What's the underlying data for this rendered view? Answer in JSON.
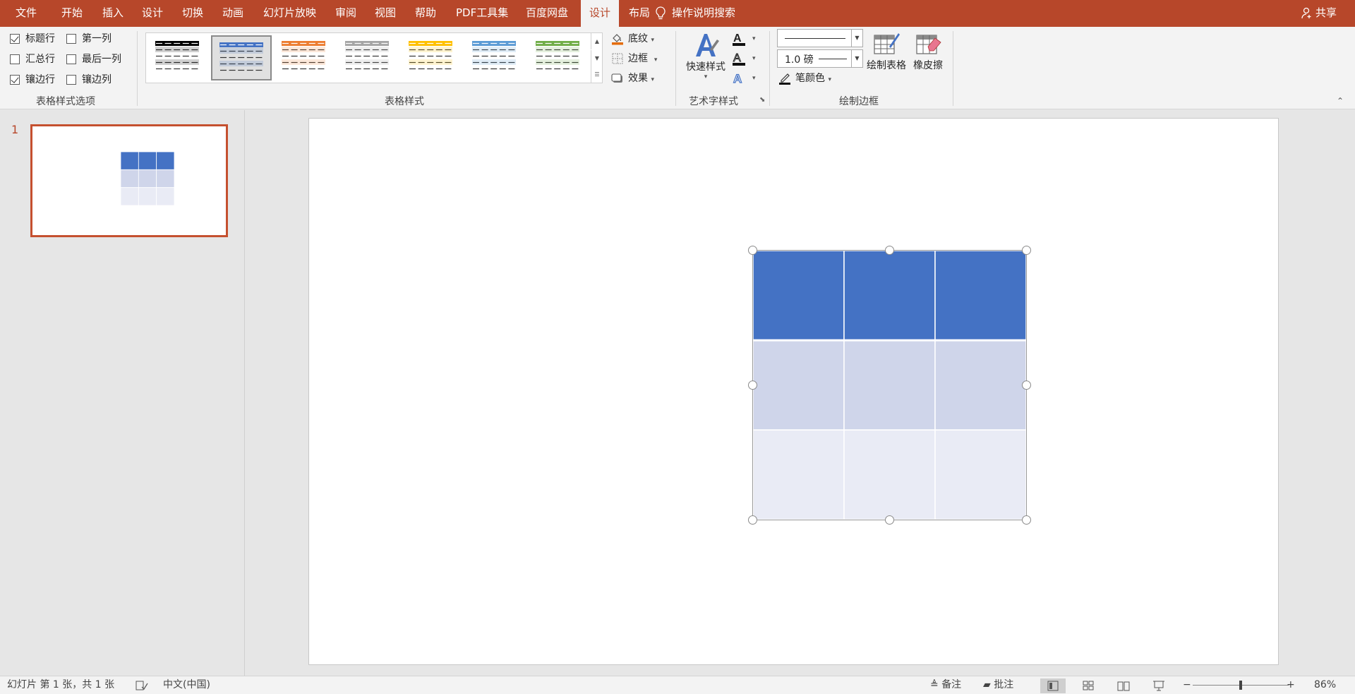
{
  "menu": {
    "tabs": [
      "文件",
      "开始",
      "插入",
      "设计",
      "切换",
      "动画",
      "幻灯片放映",
      "审阅",
      "视图",
      "帮助",
      "PDF工具集",
      "百度网盘",
      "设计",
      "布局"
    ],
    "active_tab": "设计",
    "tell_me": "操作说明搜索",
    "share": "共享"
  },
  "ribbon": {
    "style_options": {
      "header_row": {
        "label": "标题行",
        "checked": true
      },
      "first_column": {
        "label": "第一列",
        "checked": false
      },
      "total_row": {
        "label": "汇总行",
        "checked": false
      },
      "last_column": {
        "label": "最后一列",
        "checked": false
      },
      "banded_rows": {
        "label": "镶边行",
        "checked": true
      },
      "banded_columns": {
        "label": "镶边列",
        "checked": false
      },
      "group_label": "表格样式选项"
    },
    "table_styles": {
      "group_label": "表格样式",
      "thumb_colors": [
        "#000000",
        "#4472c4",
        "#ed7d31",
        "#a5a5a5",
        "#ffc000",
        "#5b9bd5",
        "#70ad47"
      ],
      "shading": "底纹",
      "borders": "边框",
      "effects": "效果"
    },
    "wordart": {
      "quick_styles": "快速样式",
      "group_label": "艺术字样式",
      "text_fill_icon": "text-fill-icon",
      "text_outline_icon": "text-outline-icon",
      "text_effects_icon": "text-effects-icon"
    },
    "draw_borders": {
      "pen_weight": "1.0 磅",
      "pen_color": "笔颜色",
      "draw_table": "绘制表格",
      "eraser": "橡皮擦",
      "group_label": "绘制边框"
    }
  },
  "slides_pane": {
    "slide_number": "1"
  },
  "table": {
    "rows": 3,
    "columns": 3,
    "header_color": "#4472c4",
    "band1_color": "#cfd5ea",
    "band2_color": "#e9ebf5"
  },
  "status": {
    "slide_info": "幻灯片 第 1 张，共 1 张",
    "language": "中文(中国)",
    "notes": "备注",
    "comments": "批注",
    "zoom_minus": "−",
    "zoom_plus": "+",
    "zoom_level": "86%",
    "zoom_slider_value": 0.5
  },
  "colors": {
    "accent": "#b7472a",
    "ribbon_bg": "#f3f3f3"
  }
}
